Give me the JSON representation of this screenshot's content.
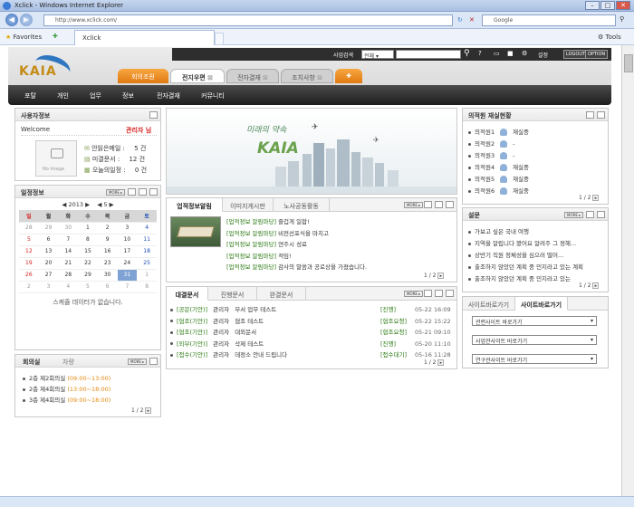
{
  "browser": {
    "title": "Xclick - Windows Internet Explorer",
    "url": "http://www.xclick.com/",
    "search_placeholder": "Google",
    "favorites_label": "Favorites",
    "tab_title": "Xclick",
    "tools_label": "Tools"
  },
  "site": {
    "logo_text": "KAIA",
    "search_label": "사업검색",
    "search_select": "전체",
    "logout_label": "LOGOUT",
    "option_label": "OPTION",
    "settings_label": "설정",
    "main_tabs": [
      "회의조원",
      "전지우편",
      "전자결재",
      "조치사항"
    ],
    "menu_items": [
      "포탈",
      "개인",
      "업무",
      "정보",
      "전자결재",
      "커뮤니티"
    ]
  },
  "user_panel": {
    "title": "사용자정보",
    "welcome": "Welcome",
    "user_name": "관리자 님",
    "no_image": "No Image",
    "stats": [
      {
        "label": "안읽은메일 :",
        "value": "5 건"
      },
      {
        "label": "미결문서 :",
        "value": "12 건"
      },
      {
        "label": "오늘의일정 :",
        "value": "0 건"
      }
    ]
  },
  "calendar_panel": {
    "title": "일정정보",
    "year": "2013",
    "month": "5",
    "weekdays": [
      "일",
      "월",
      "화",
      "수",
      "목",
      "금",
      "토"
    ],
    "weeks": [
      [
        "28",
        "29",
        "30",
        "1",
        "2",
        "3",
        "4"
      ],
      [
        "5",
        "6",
        "7",
        "8",
        "9",
        "10",
        "11"
      ],
      [
        "12",
        "13",
        "14",
        "15",
        "16",
        "17",
        "18"
      ],
      [
        "19",
        "20",
        "21",
        "22",
        "23",
        "24",
        "25"
      ],
      [
        "26",
        "27",
        "28",
        "29",
        "30",
        "31",
        "1"
      ],
      [
        "2",
        "3",
        "4",
        "5",
        "6",
        "7",
        "8"
      ]
    ],
    "empty_text": "스케쥴 데이터가 없습니다."
  },
  "meeting_panel": {
    "tabs": [
      "회의실",
      "차량"
    ],
    "items": [
      {
        "room": "2층 제2회의실",
        "time": "(09:00~13:00)"
      },
      {
        "room": "2층 제4회의실",
        "time": "(13:00~18:00)"
      },
      {
        "room": "3층 제4회의실",
        "time": "(09:00~18:00)"
      }
    ],
    "pager": "1 / 2"
  },
  "banner": {
    "slogan": "미래의 약속",
    "brand": "KAIA"
  },
  "notice_panel": {
    "tabs": [
      "업적정보알림",
      "이미지게시판",
      "노사공동활동"
    ],
    "prefix": "[업적정보 알림마당]",
    "items": [
      "즐겁게 일합!",
      "비전선포식을 마치고",
      "연주시 성료",
      "적임!",
      "감사의 말씀과 공로상을 가졌습니다."
    ],
    "pager": "1 / 2"
  },
  "doc_panel": {
    "tabs": [
      "대결문서",
      "진행문서",
      "완결문서"
    ],
    "rows": [
      {
        "type": "[공문(기안)]",
        "author": "관리자",
        "title": "부서 업무 테스트",
        "status": "[진행]",
        "date": "05-22 16:09"
      },
      {
        "type": "[협조(기안)]",
        "author": "관리자",
        "title": "협조 테스트",
        "status": "[협조요청]",
        "date": "05-22 15:22"
      },
      {
        "type": "[협조(기안)]",
        "author": "관리자",
        "title": "대외문서",
        "status": "[협조요청]",
        "date": "05-21 09:10"
      },
      {
        "type": "[외부(기안)]",
        "author": "관리자",
        "title": "삭제 테스트",
        "status": "[진행]",
        "date": "05-20 11:10"
      },
      {
        "type": "[접수(기안)]",
        "author": "관리자",
        "title": "데정소 안내 드립니다",
        "status": "[접수대기]",
        "date": "05-16 11:28"
      }
    ],
    "pager": "1 / 2"
  },
  "approval_panel": {
    "title": "의적원 재실현황",
    "rows": [
      {
        "name": "의적원1",
        "status": "재실중"
      },
      {
        "name": "의적원2",
        "status": "-"
      },
      {
        "name": "의적원3",
        "status": "-"
      },
      {
        "name": "의적원4",
        "status": "재실중"
      },
      {
        "name": "의적원5",
        "status": "재실중"
      },
      {
        "name": "의적원6",
        "status": "재실중"
      }
    ],
    "pager": "1 / 2"
  },
  "poll_panel": {
    "title": "설문",
    "items": [
      "가보고 싶은 국내 여행",
      "지역을 알립니다 봤어요 알려주 그 정해...",
      "상반기 직원 정체성을 심으러 떨어...",
      "출조하지 않았던 계획 중 민지라고 있는 계획",
      "출조하지 않았던 계획 중 민지라고 있는"
    ],
    "pager": "1 / 2"
  },
  "site_links": {
    "tabs": [
      "사이트바로가기",
      "사이트바로가기"
    ],
    "selects": [
      "관련사이트 바로가기",
      "사업관사이트 바로가기",
      "연구관사이트 바로가기"
    ]
  }
}
